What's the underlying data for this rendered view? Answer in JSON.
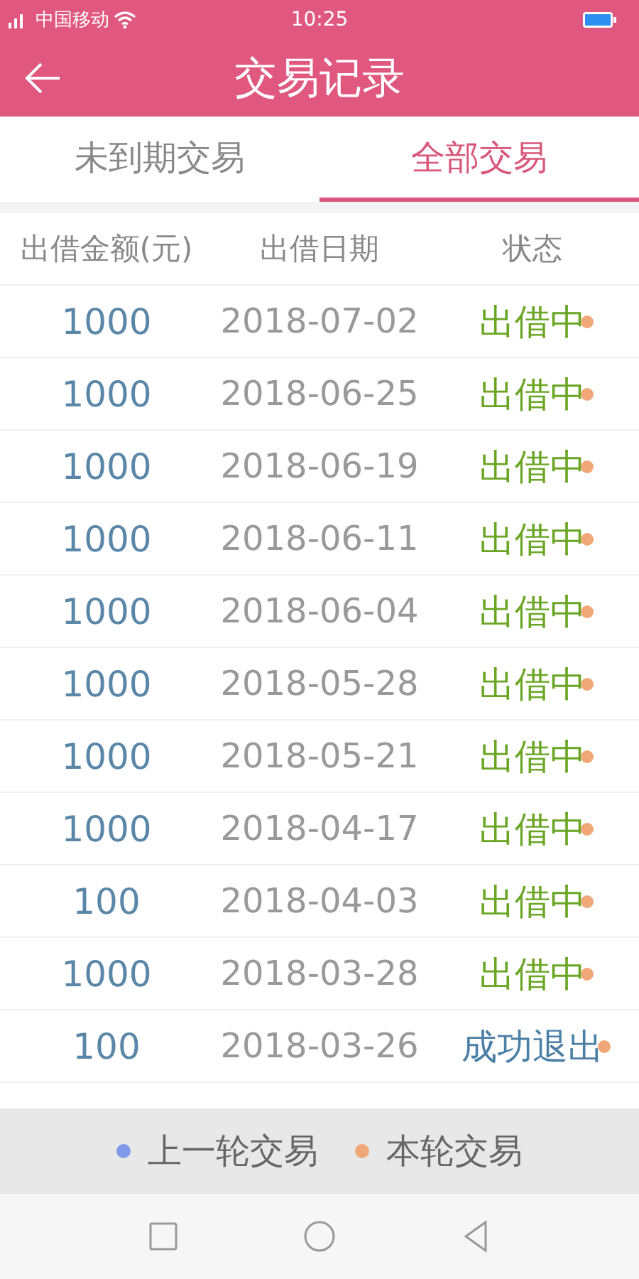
{
  "status_bar": {
    "carrier": "中国移动",
    "time": "10:25"
  },
  "header": {
    "title": "交易记录"
  },
  "tabs": [
    {
      "label": "未到期交易",
      "selected": false
    },
    {
      "label": "全部交易",
      "selected": true
    }
  ],
  "table": {
    "columns": [
      "出借金额(元)",
      "出借日期",
      "状态"
    ],
    "rows": [
      {
        "amount": "1000",
        "date": "2018-07-02",
        "status": "出借中",
        "kind": "lending",
        "color": "#f0a878"
      },
      {
        "amount": "1000",
        "date": "2018-06-25",
        "status": "出借中",
        "kind": "lending",
        "color": "#f0a878"
      },
      {
        "amount": "1000",
        "date": "2018-06-19",
        "status": "出借中",
        "kind": "lending",
        "color": "#f0a878"
      },
      {
        "amount": "1000",
        "date": "2018-06-11",
        "status": "出借中",
        "kind": "lending",
        "color": "#f0a878"
      },
      {
        "amount": "1000",
        "date": "2018-06-04",
        "status": "出借中",
        "kind": "lending",
        "color": "#f0a878"
      },
      {
        "amount": "1000",
        "date": "2018-05-28",
        "status": "出借中",
        "kind": "lending",
        "color": "#f0a878"
      },
      {
        "amount": "1000",
        "date": "2018-05-21",
        "status": "出借中",
        "kind": "lending",
        "color": "#f0a878"
      },
      {
        "amount": "1000",
        "date": "2018-04-17",
        "status": "出借中",
        "kind": "lending",
        "color": "#f0a878"
      },
      {
        "amount": "100",
        "date": "2018-04-03",
        "status": "出借中",
        "kind": "lending",
        "color": "#f0a878"
      },
      {
        "amount": "1000",
        "date": "2018-03-28",
        "status": "出借中",
        "kind": "lending",
        "color": "#f0a878"
      },
      {
        "amount": "100",
        "date": "2018-03-26",
        "status": "成功退出",
        "kind": "exited",
        "color": "#f0a878"
      }
    ]
  },
  "legend": [
    {
      "label": "上一轮交易",
      "color": "#7f9ae8"
    },
    {
      "label": "本轮交易",
      "color": "#f0a878"
    }
  ]
}
